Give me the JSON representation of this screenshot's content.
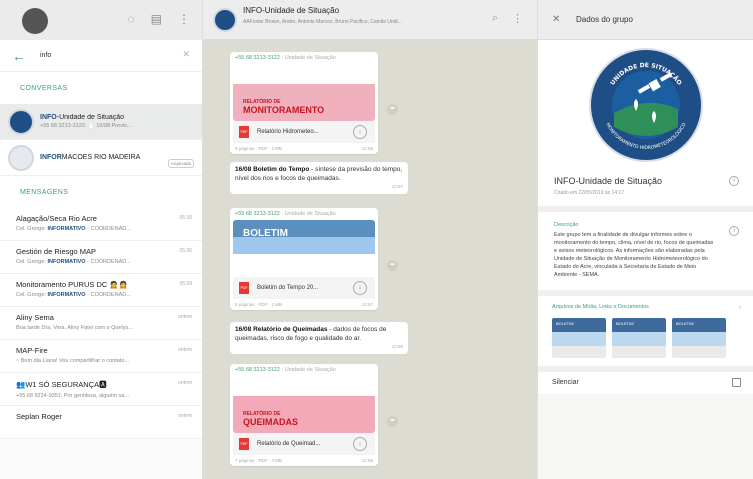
{
  "left": {
    "search": {
      "text": "info"
    },
    "conversations_label": "CONVERSAS",
    "conversations": [
      {
        "title_bold": "INFO",
        "title_rest": "-Unidade de Situação",
        "sub": "+55 68 3213-3122: 📄 16/08 Previs...",
        "time": "",
        "badge": ""
      },
      {
        "title_bold": "INFOR",
        "title_rest": "MACÕES RIO MADEIRA",
        "sub": "",
        "time": "",
        "badge": "Arquivada"
      }
    ],
    "messages_label": "MENSAGENS",
    "messages": [
      {
        "title": "Alagação/Seca Rio Acre",
        "sub_pre": "Cel. Grorge: ",
        "sub_bold": "INFORMATIVO",
        "sub_post": " - COORDENAD...",
        "time": "05:39"
      },
      {
        "title": "Gestión de Riesgo MAP",
        "sub_pre": "Cel. Grorge: ",
        "sub_bold": "INFORMATIVO",
        "sub_post": " - COORDENAD...",
        "time": "05:36"
      },
      {
        "title": "Monitoramento PURUS DC 🙍🙍",
        "sub_pre": "Cel. Grorge: ",
        "sub_bold": "INFORMATIVO",
        "sub_post": " - COORDENAD...",
        "time": "05:29"
      },
      {
        "title": "Aliny Sema",
        "sub_pre": "Boa tarde Dra. Vera. Aliny Fatel com o Quelys...",
        "sub_bold": "",
        "sub_post": "",
        "time": "ontem"
      },
      {
        "title": "MAP-Fire",
        "sub_pre": "~ Bom dia Liana! Vou compartilhar o contato...",
        "sub_bold": "",
        "sub_post": "",
        "time": "ontem"
      },
      {
        "title": "👥W1 SÓ SEGURANÇA🅰",
        "sub_pre": "+55 68 9224-9351: Por gentileza, alguém sa...",
        "sub_bold": "",
        "sub_post": "",
        "time": "ontem"
      },
      {
        "title": "Seplan Roger",
        "sub_pre": "",
        "sub_bold": "",
        "sub_post": "",
        "time": "ontem"
      }
    ]
  },
  "chat": {
    "title": "INFO-Unidade de Situação",
    "members": "AAFoster Brown, Andre, Antonio Marcos, Bruno Pacifico, Camila Unid...",
    "bubbles": [
      {
        "sender": "+55 68 3213-3122",
        "sender_note": " · Unidade de Situação",
        "headline_small": "RELATÓRIO DE",
        "headline": "MONITORAMENTO",
        "file": "Relatório Hidrometeo...",
        "meta_left": "9 páginas · PDF · 2 MB",
        "meta_right": "12:56"
      },
      {
        "sender": "+55 68 3213-3122",
        "sender_note": " · Unidade de Situação",
        "headline_small": "",
        "headline": "BOLETIM",
        "file": "Boletim do Tempo 20...",
        "meta_left": "5 páginas · PDF · 2 MB",
        "meta_right": "12:57"
      },
      {
        "sender": "+55 68 3213-3122",
        "sender_note": " · Unidade de Situação",
        "headline_small": "RELATÓRIO DE",
        "headline": "QUEIMADAS",
        "file": "Relatório de Queimad...",
        "meta_left": "7 páginas · PDF · 3 MB",
        "meta_right": "12:58"
      }
    ],
    "texts": [
      {
        "bold": "16/08 Boletim do Tempo",
        "rest": " - síntese da previsão do tempo, nível dos rios e focos de queimadas.",
        "time": "12:57"
      },
      {
        "bold": "16/08 Relatório de Queimadas",
        "rest": " - dados de focos de queimadas, risco de fogo e qualidade do ar.",
        "time": "12:58"
      }
    ]
  },
  "details": {
    "title": "Dados do grupo",
    "logo_top": "UNIDADE DE SITUAÇÃO",
    "logo_bottom": "MONITORAMENTO HIDROMETEOROLÓGICO",
    "name": "INFO-Unidade de Situação",
    "created": "Criado em 22/05/2019 às 14:17",
    "desc_label": "Descrição",
    "desc_text": "Este grupo tem a finalidade de divulgar informes sobre o monitoramento do tempo, clima, nível de rio, focos de queimadas e avisos meteorológicos. As informações são elaboradas pela Unidade de Situação de Monitoramento Hidrometeorológico do Estado do Acre, vinculada à Secretaria de Estado de Meio Ambiente - SEMA.",
    "media_label": "Arquivos de Mídia, Links e Documentos",
    "media_thumbs": [
      "BOLETIM",
      "BOLETIM",
      "BOLETIM"
    ],
    "silence_label": "Silenciar"
  },
  "colors": {
    "accent": "#3a9b8a",
    "brand_blue": "#1f4e86",
    "sender_green": "#41a16c",
    "pdf_red": "#e53935"
  }
}
